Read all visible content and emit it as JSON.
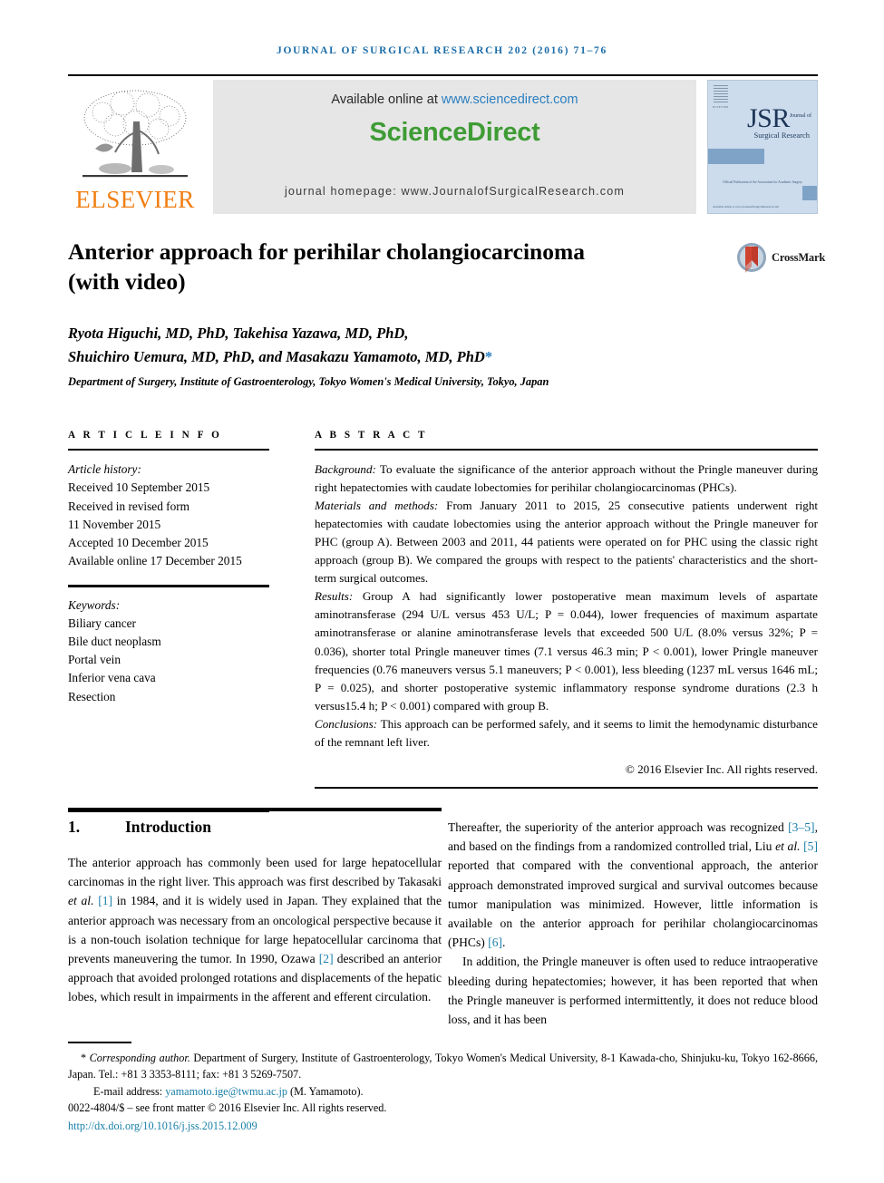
{
  "running_head": "JOURNAL OF SURGICAL RESEARCH 202 (2016) 71–76",
  "masthead": {
    "publisher_name": "ELSEVIER",
    "available_prefix": "Available online at ",
    "sciencedirect_url": "www.sciencedirect.com",
    "sciencedirect_logo": "ScienceDirect",
    "journal_homepage": "journal homepage: www.JournalofSurgicalResearch.com",
    "cover": {
      "acronym": "JSR",
      "acronym_sup": "Journal of",
      "subtitle": "Surgical Research",
      "note": "Official Publication of the\nAssociation for Academic Surgery",
      "foot": "Available online at\nwww.JournalofSurgicalResearch.com",
      "els_label": "ELSEVIER"
    }
  },
  "article": {
    "title": "Anterior approach for perihilar cholangiocarcinoma (with video)",
    "crossmark_label": "CrossMark",
    "authors_line1": "Ryota Higuchi, MD, PhD, Takehisa Yazawa, MD, PhD,",
    "authors_line2": "Shuichiro Uemura, MD, PhD, and Masakazu Yamamoto, MD, PhD",
    "authors_star": "*",
    "affiliation": "Department of Surgery, Institute of Gastroenterology, Tokyo Women's Medical University, Tokyo, Japan"
  },
  "article_info": {
    "heading": "A R T I C L E   I N F O",
    "history_label": "Article history:",
    "history": [
      "Received 10 September 2015",
      "Received in revised form",
      "11 November 2015",
      "Accepted 10 December 2015",
      "Available online 17 December 2015"
    ],
    "keywords_label": "Keywords:",
    "keywords": [
      "Biliary cancer",
      "Bile duct neoplasm",
      "Portal vein",
      "Inferior vena cava",
      "Resection"
    ]
  },
  "abstract": {
    "heading": "A B S T R A C T",
    "background_label": "Background:",
    "background_text": " To evaluate the significance of the anterior approach without the Pringle maneuver during right hepatectomies with caudate lobectomies for perihilar cholangiocarcinomas (PHCs).",
    "methods_label": "Materials and methods:",
    "methods_text": " From January 2011 to 2015, 25 consecutive patients underwent right hepatectomies with caudate lobectomies using the anterior approach without the Pringle maneuver for PHC (group A). Between 2003 and 2011, 44 patients were operated on for PHC using the classic right approach (group B). We compared the groups with respect to the patients' characteristics and the short-term surgical outcomes.",
    "results_label": "Results:",
    "results_text": " Group A had significantly lower postoperative mean maximum levels of aspartate aminotransferase (294 U/L versus 453 U/L; P = 0.044), lower frequencies of maximum aspartate aminotransferase or alanine aminotransferase levels that exceeded 500 U/L (8.0% versus 32%; P = 0.036), shorter total Pringle maneuver times (7.1 versus 46.3 min; P < 0.001), lower Pringle maneuver frequencies (0.76 maneuvers versus 5.1 maneuvers; P < 0.001), less bleeding (1237 mL versus 1646 mL; P = 0.025), and shorter postoperative systemic inflammatory response syndrome durations (2.3 h versus15.4 h; P < 0.001) compared with group B.",
    "conclusions_label": "Conclusions:",
    "conclusions_text": " This approach can be performed safely, and it seems to limit the hemodynamic disturbance of the remnant left liver.",
    "copyright": "© 2016 Elsevier Inc. All rights reserved."
  },
  "body": {
    "section_number": "1.",
    "section_title": "Introduction",
    "left_paragraph": "The anterior approach has commonly been used for large hepatocellular carcinomas in the right liver. This approach was first described by Takasaki et al. [1] in 1984, and it is widely used in Japan. They explained that the anterior approach was necessary from an oncological perspective because it is a non-touch isolation technique for large hepatocellular carcinoma that prevents maneuvering the tumor. In 1990, Ozawa [2] described an anterior approach that avoided prolonged rotations and displacements of the hepatic lobes, which result in impairments in the afferent and efferent circulation.",
    "right_paragraph_1": "Thereafter, the superiority of the anterior approach was recognized [3–5], and based on the findings from a randomized controlled trial, Liu et al. [5] reported that compared with the conventional approach, the anterior approach demonstrated improved surgical and survival outcomes because tumor manipulation was minimized. However, little information is available on the anterior approach for perihilar cholangiocarcinomas (PHCs) [6].",
    "right_paragraph_2": "In addition, the Pringle maneuver is often used to reduce intraoperative bleeding during hepatectomies; however, it has been reported that when the Pringle maneuver is performed intermittently, it does not reduce blood loss, and it has been",
    "refs": {
      "r1": "[1]",
      "r2": "[2]",
      "r35": "[3–5]",
      "r5": "[5]",
      "r6": "[6]"
    }
  },
  "footer": {
    "corresponding_star": "*",
    "corresponding_label": "Corresponding author.",
    "corresponding_text": " Department of Surgery, Institute of Gastroenterology, Tokyo Women's Medical University, 8-1 Kawada-cho, Shinjuku-ku, Tokyo 162-8666, Japan. Tel.: +81 3 3353-8111; fax: +81 3 5269-7507.",
    "email_label": "E-mail address: ",
    "email": "yamamoto.ige@twmu.ac.jp",
    "email_suffix": " (M. Yamamoto).",
    "issn_line": "0022-4804/$ – see front matter © 2016 Elsevier Inc. All rights reserved.",
    "doi": "http://dx.doi.org/10.1016/j.jss.2015.12.009"
  },
  "colors": {
    "link_blue": "#1a7fa8",
    "sciencedirect_green": "#3f9c35",
    "elsevier_orange": "#F07F13",
    "running_head_blue": "#1b6ca8"
  }
}
